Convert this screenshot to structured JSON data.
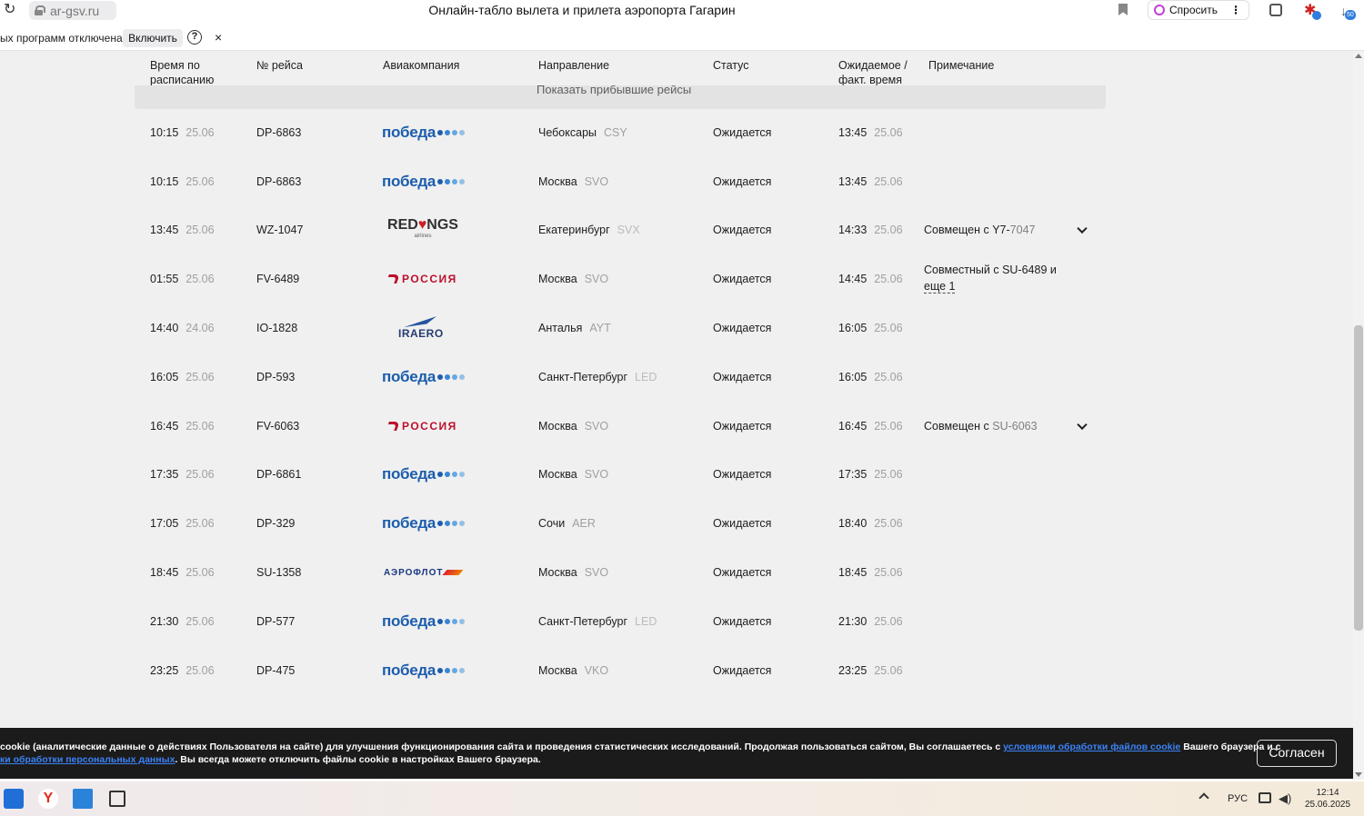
{
  "browser": {
    "url": "ar-gsv.ru",
    "page_title": "Онлайн-табло вылета и прилета аэропорта Гагарин",
    "ask_label": "Спросить",
    "downloads_badge": "50"
  },
  "infobar": {
    "text": "ых программ отключена",
    "enable_label": "Включить",
    "help": "?",
    "close": "×"
  },
  "table": {
    "headers": {
      "scheduled": [
        "Время по",
        "расписанию"
      ],
      "flight": "№ рейса",
      "airline": "Авиакомпания",
      "direction": "Направление",
      "status": "Статус",
      "expected": [
        "Ожидаемое /",
        "факт. время"
      ],
      "note": "Примечание"
    },
    "show_arrived": "Показать прибывшие рейсы",
    "rows": [
      {
        "time": "10:15",
        "date": "25.06",
        "flight": "DP-6863",
        "airline": "pobeda",
        "city": "Чебоксары",
        "code": "CSY",
        "status": "Ожидается",
        "exp_time": "13:45",
        "exp_date": "25.06",
        "note": "",
        "note_code": ""
      },
      {
        "time": "10:15",
        "date": "25.06",
        "flight": "DP-6863",
        "airline": "pobeda",
        "city": "Москва",
        "code": "SVO",
        "status": "Ожидается",
        "exp_time": "13:45",
        "exp_date": "25.06",
        "note": "",
        "note_code": ""
      },
      {
        "time": "13:45",
        "date": "25.06",
        "flight": "WZ-1047",
        "airline": "redwings",
        "city": "Екатеринбург",
        "code": "SVX",
        "status": "Ожидается",
        "exp_time": "14:33",
        "exp_date": "25.06",
        "note": "Совмещен с Y7-",
        "note_code": "7047"
      },
      {
        "time": "01:55",
        "date": "25.06",
        "flight": "FV-6489",
        "airline": "rossiya",
        "city": "Москва",
        "code": "SVO",
        "status": "Ожидается",
        "exp_time": "14:45",
        "exp_date": "25.06",
        "note": "Совместный с SU-6489  и",
        "note_code": "",
        "note_more": "еще 1"
      },
      {
        "time": "14:40",
        "date": "24.06",
        "flight": "IO-1828",
        "airline": "iraero",
        "city": "Анталья",
        "code": "AYT",
        "status": "Ожидается",
        "exp_time": "16:05",
        "exp_date": "25.06",
        "note": "",
        "note_code": ""
      },
      {
        "time": "16:05",
        "date": "25.06",
        "flight": "DP-593",
        "airline": "pobeda",
        "city": "Санкт-Петербург",
        "code": "LED",
        "status": "Ожидается",
        "exp_time": "16:05",
        "exp_date": "25.06",
        "note": "",
        "note_code": ""
      },
      {
        "time": "16:45",
        "date": "25.06",
        "flight": "FV-6063",
        "airline": "rossiya",
        "city": "Москва",
        "code": "SVO",
        "status": "Ожидается",
        "exp_time": "16:45",
        "exp_date": "25.06",
        "note": "Совмещен с ",
        "note_code": "SU-6063"
      },
      {
        "time": "17:35",
        "date": "25.06",
        "flight": "DP-6861",
        "airline": "pobeda",
        "city": "Москва",
        "code": "SVO",
        "status": "Ожидается",
        "exp_time": "17:35",
        "exp_date": "25.06",
        "note": "",
        "note_code": ""
      },
      {
        "time": "17:05",
        "date": "25.06",
        "flight": "DP-329",
        "airline": "pobeda",
        "city": "Сочи",
        "code": "AER",
        "status": "Ожидается",
        "exp_time": "18:40",
        "exp_date": "25.06",
        "note": "",
        "note_code": ""
      },
      {
        "time": "18:45",
        "date": "25.06",
        "flight": "SU-1358",
        "airline": "aeroflot",
        "city": "Москва",
        "code": "SVO",
        "status": "Ожидается",
        "exp_time": "18:45",
        "exp_date": "25.06",
        "note": "",
        "note_code": ""
      },
      {
        "time": "21:30",
        "date": "25.06",
        "flight": "DP-577",
        "airline": "pobeda",
        "city": "Санкт-Петербург",
        "code": "LED",
        "status": "Ожидается",
        "exp_time": "21:30",
        "exp_date": "25.06",
        "note": "",
        "note_code": ""
      },
      {
        "time": "23:25",
        "date": "25.06",
        "flight": "DP-475",
        "airline": "pobeda",
        "city": "Москва",
        "code": "VKO",
        "status": "Ожидается",
        "exp_time": "23:25",
        "exp_date": "25.06",
        "note": "",
        "note_code": ""
      }
    ]
  },
  "logos": {
    "pobeda": "победа",
    "redwings_a": "RED",
    "redwings_b": "NGS",
    "redwings_sub": "airlines",
    "rossiya": "РОССИЯ",
    "iraero": "IRAERO",
    "aeroflot": "АЭРОФЛОТ",
    "pobeda_dot_colors": [
      "#1e63b8",
      "#3d8fe0",
      "#6fb2ef",
      "#9ccdf5"
    ]
  },
  "cookie": {
    "line1_a": "cookie (аналитические данные о действиях Пользователя на сайте) для улучшения функционирования сайта и проведения статистических исследований. Продолжая пользоваться сайтом, Вы соглашаетесь с ",
    "line1_link": "условиями обработки файлов cookie",
    "line1_b": " Вашего браузера и с",
    "line2_link": "ки обработки персональных данных",
    "line2_b": ". Вы всегда можете отключить файлы cookie в настройках Вашего браузера.",
    "agree_label": "Согласен"
  },
  "taskbar": {
    "lang": "РУС",
    "time": "12:14",
    "date": "25.06.2025",
    "yandex": "Y"
  }
}
